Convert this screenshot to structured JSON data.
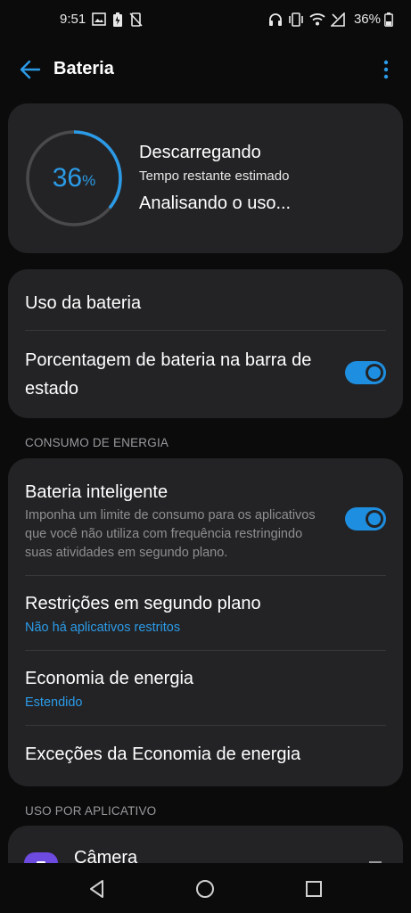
{
  "status_bar": {
    "time": "9:51",
    "battery_percent": "36%",
    "left_icons": [
      "gallery-icon",
      "battery-saver-icon",
      "no-notifications-icon"
    ],
    "right_icons": [
      "headset-icon",
      "vibrate-icon",
      "wifi-icon",
      "signal-icon"
    ]
  },
  "header": {
    "title": "Bateria"
  },
  "battery_card": {
    "level_value": 36,
    "level_number": "36",
    "level_unit": "%",
    "state": "Descarregando",
    "estimate_label": "Tempo restante estimado",
    "estimate_value": "Analisando o uso..."
  },
  "settings": {
    "battery_usage": "Uso da bateria",
    "status_bar_percentage": "Porcentagem de bateria na barra de estado",
    "status_bar_percentage_on": true
  },
  "power_section": {
    "header": "CONSUMO DE ENERGIA",
    "smart_battery": {
      "title": "Bateria inteligente",
      "description": "Imponha um limite de consumo para os aplicativos que você não utiliza com frequência restringindo suas atividades em segundo plano.",
      "on": true
    },
    "background_restrictions": {
      "title": "Restrições em segundo plano",
      "subtitle": "Não há aplicativos restritos"
    },
    "power_saving": {
      "title": "Economia de energia",
      "subtitle": "Estendido"
    },
    "power_saving_exceptions": {
      "title": "Exceções da Economia de energia"
    }
  },
  "apps_section": {
    "header": "USO POR APLICATIVO",
    "apps": [
      {
        "name": "Câmera",
        "icon": "camera-app-icon"
      }
    ]
  },
  "colors": {
    "accent": "#2b9be8",
    "card": "#232325",
    "background": "#0b0b0c"
  }
}
